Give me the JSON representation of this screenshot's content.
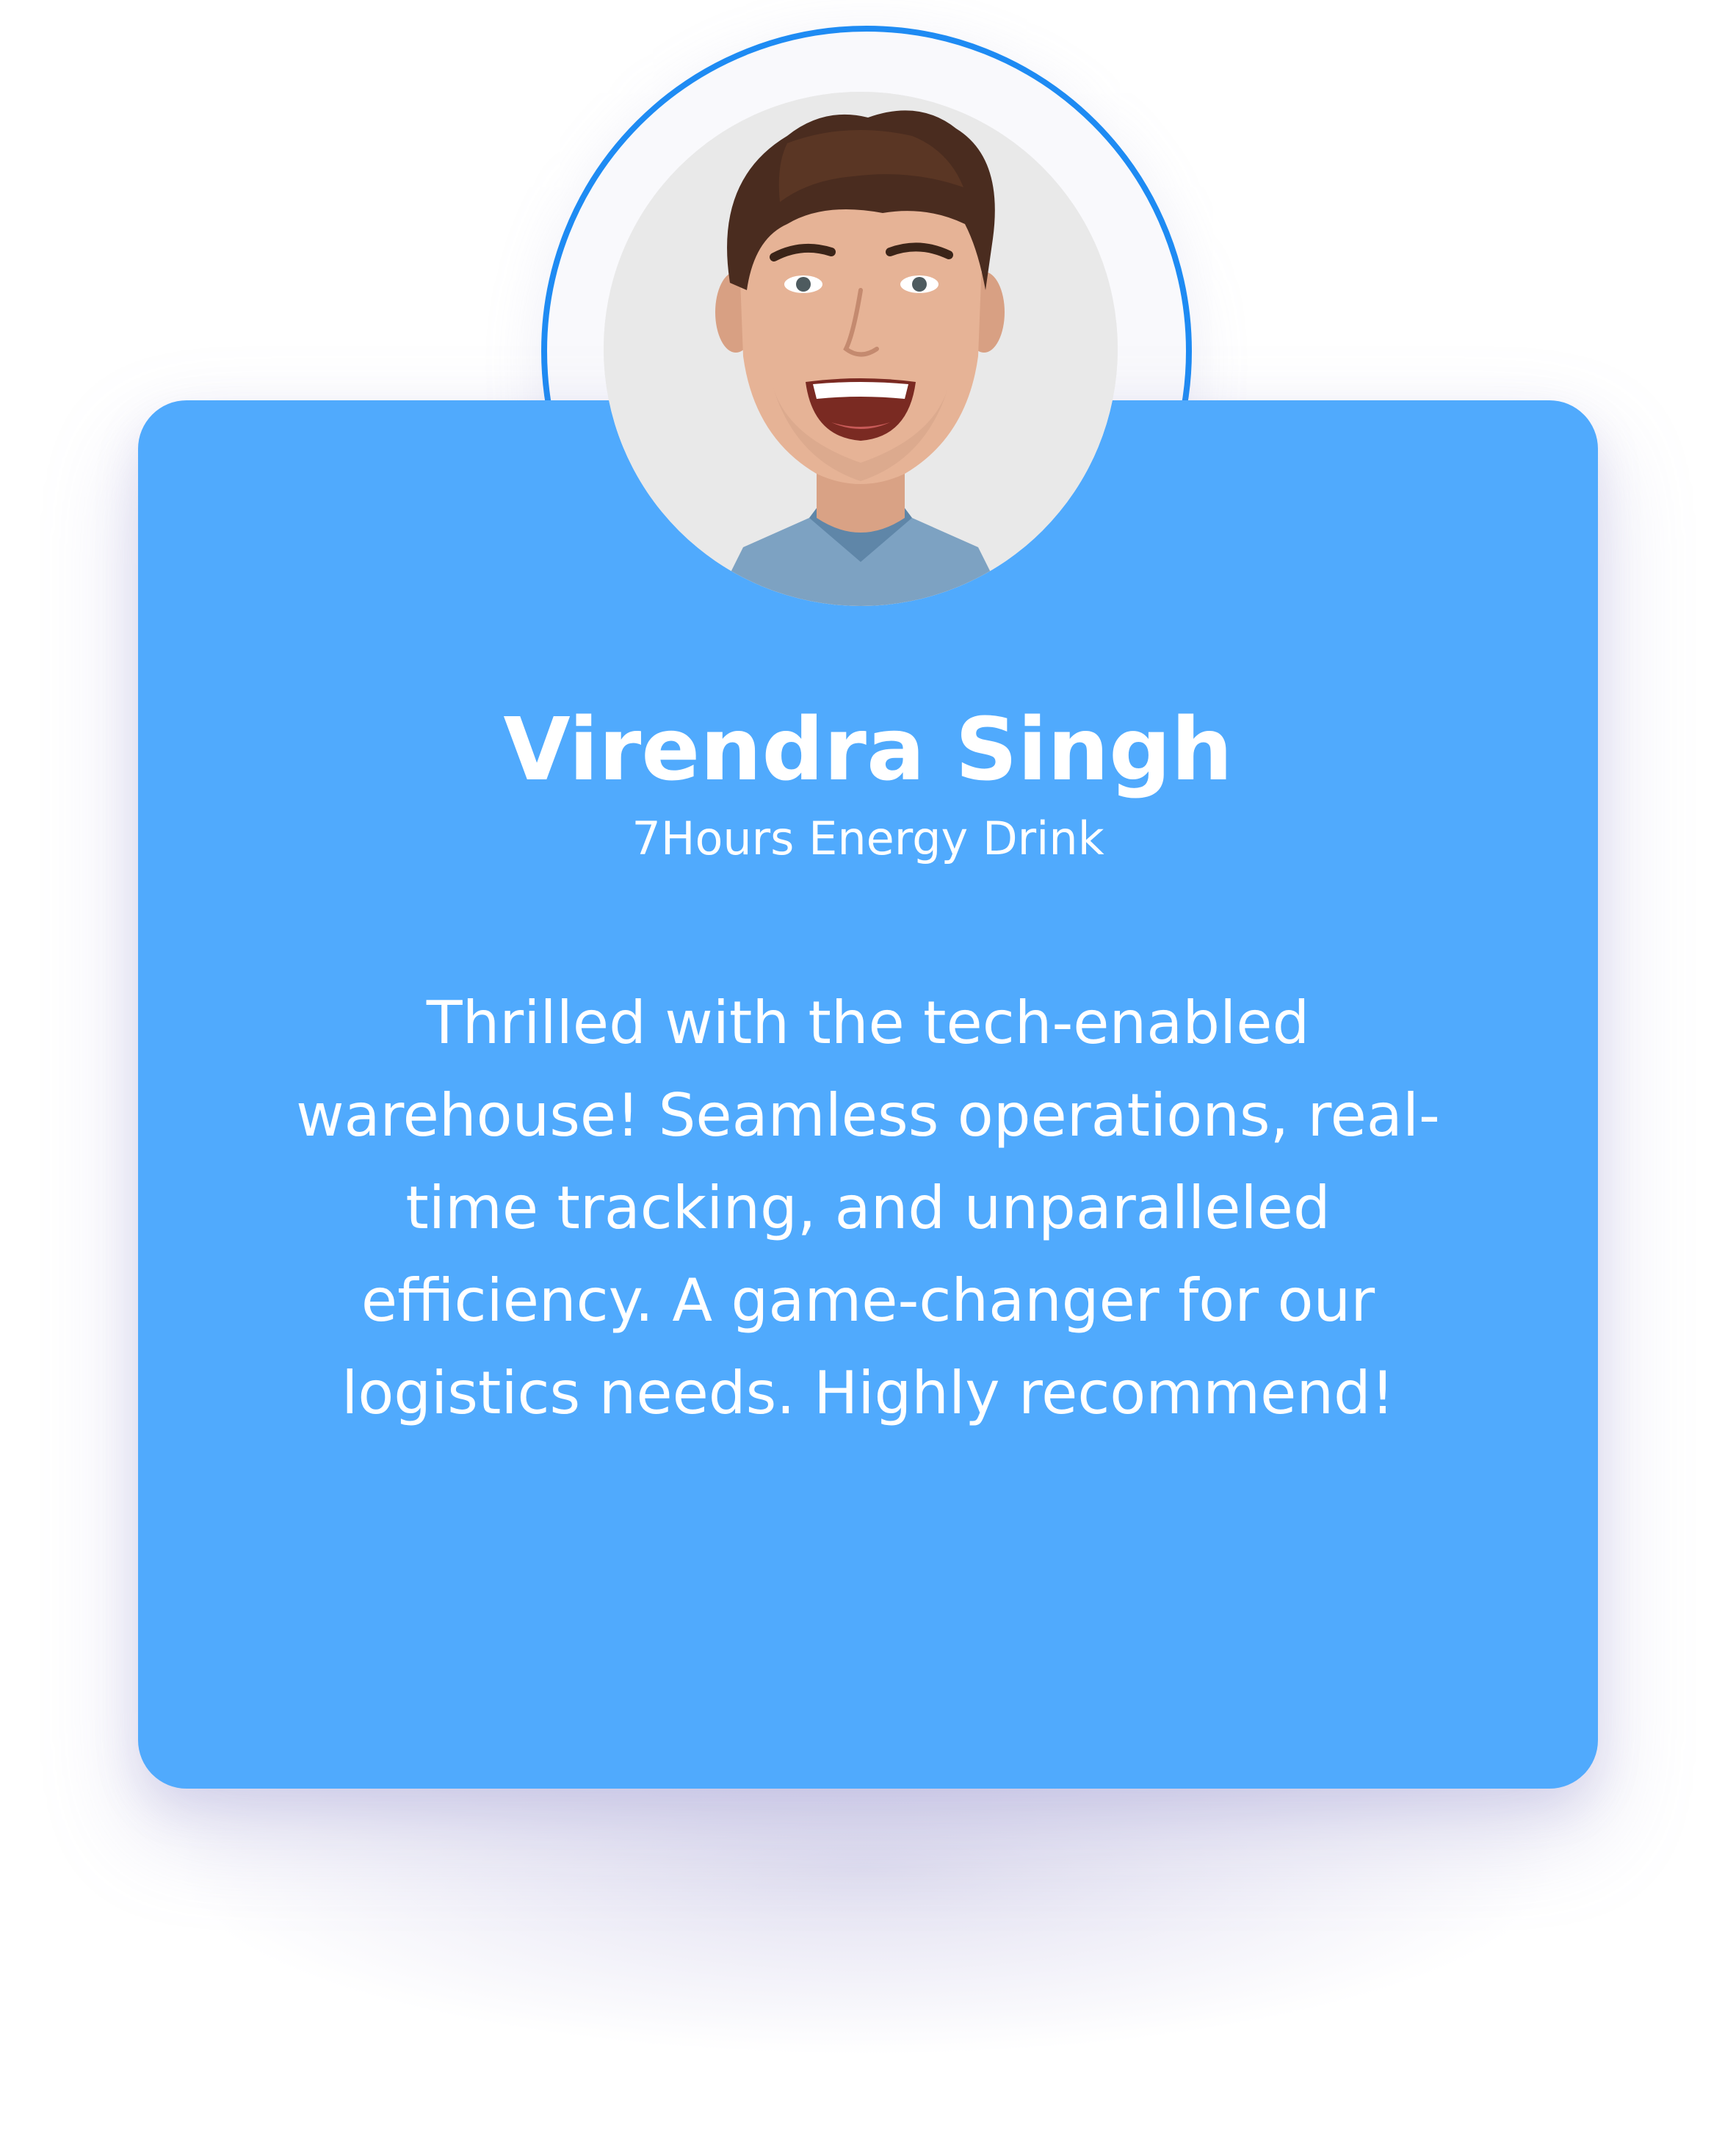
{
  "testimonial": {
    "name": "Virendra Singh",
    "company": "7Hours Energy Drink",
    "quote": "Thrilled with the tech-enabled warehouse! Seamless operations, real-time tracking, and unparalleled efficiency. A game-changer for our logistics needs. Highly recommend!"
  },
  "colors": {
    "card_background": "#50aafd",
    "avatar_ring": "#1e8bf3",
    "text": "#ffffff",
    "page_background": "#ffffff"
  }
}
